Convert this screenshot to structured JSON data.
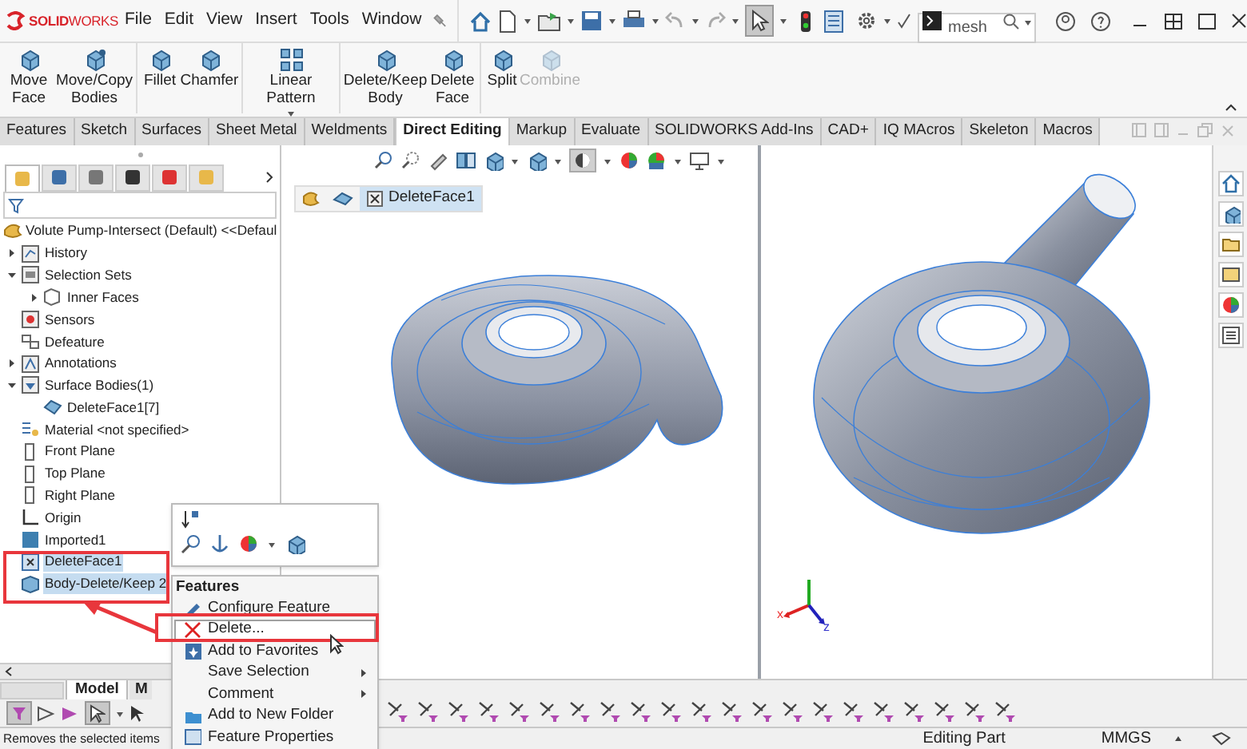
{
  "title_bar": {
    "logo": "**SOLID**WORKS",
    "menus": [
      "File",
      "Edit",
      "View",
      "Insert",
      "Tools",
      "Window"
    ],
    "search": {
      "value": "mesh"
    }
  },
  "ribbon": {
    "buttons": [
      {
        "label": "Move Face",
        "disabled": false
      },
      {
        "label": "Move/Copy Bodies",
        "disabled": false
      },
      {
        "label": "Fillet",
        "disabled": false
      },
      {
        "label": "Chamfer",
        "disabled": false
      },
      {
        "label": "Linear Pattern",
        "disabled": false
      },
      {
        "label": "Delete/Keep Body",
        "disabled": false
      },
      {
        "label": "Delete Face",
        "disabled": false
      },
      {
        "label": "Split",
        "disabled": false
      },
      {
        "label": "Combine",
        "disabled": true
      }
    ]
  },
  "tabs": [
    {
      "label": "Features",
      "selected": false
    },
    {
      "label": "Sketch",
      "selected": false
    },
    {
      "label": "Surfaces",
      "selected": false
    },
    {
      "label": "Sheet Metal",
      "selected": false
    },
    {
      "label": "Weldments",
      "selected": false
    },
    {
      "label": "Direct Editing",
      "selected": true
    },
    {
      "label": "Markup",
      "selected": false
    },
    {
      "label": "Evaluate",
      "selected": false
    },
    {
      "label": "SOLIDWORKS Add-Ins",
      "selected": false
    },
    {
      "label": "CAD+",
      "selected": false
    },
    {
      "label": "IQ MAcros",
      "selected": false
    },
    {
      "label": "Skeleton",
      "selected": false
    },
    {
      "label": "Macros",
      "selected": false
    }
  ],
  "panel_tabs": [
    {
      "selected": true
    },
    {
      "selected": false
    },
    {
      "selected": false
    },
    {
      "selected": false
    },
    {
      "selected": false
    },
    {
      "selected": false
    }
  ],
  "feature_tree": {
    "root": "Volute Pump-Intersect (Default) <<Defaul",
    "items": [
      {
        "label": "History",
        "expanded": false,
        "selected": false
      },
      {
        "label": "Selection Sets",
        "expanded": true,
        "selected": false,
        "children": [
          {
            "label": "Inner Faces",
            "expanded": false,
            "selected": false
          }
        ]
      },
      {
        "label": "Sensors",
        "selected": false
      },
      {
        "label": "Defeature",
        "selected": false
      },
      {
        "label": "Annotations",
        "expanded": false,
        "selected": false
      },
      {
        "label": "Surface Bodies(1)",
        "expanded": true,
        "selected": false,
        "children": [
          {
            "label": "DeleteFace1[7]",
            "selected": false
          }
        ]
      },
      {
        "label": "Material <not specified>",
        "selected": false
      },
      {
        "label": "Front Plane",
        "selected": false
      },
      {
        "label": "Top Plane",
        "selected": false
      },
      {
        "label": "Right Plane",
        "selected": false
      },
      {
        "label": "Origin",
        "selected": false
      },
      {
        "label": "Imported1",
        "selected": false
      },
      {
        "label": "DeleteFace1",
        "selected": true
      },
      {
        "label": "Body-Delete/Keep 2",
        "selected": true
      }
    ]
  },
  "breadcrumb": {
    "item": "DeleteFace1"
  },
  "triad": {
    "labels": [
      "x",
      "z"
    ]
  },
  "bottom_tabs": [
    {
      "label": "Model",
      "selected": true
    },
    {
      "label": "M",
      "selected": false
    }
  ],
  "context_menu": {
    "header": "Features",
    "items": [
      {
        "label": "Configure Feature",
        "submenu": false,
        "hovered": false
      },
      {
        "label": "Delete...",
        "submenu": false,
        "hovered": true
      },
      {
        "label": "Add to Favorites",
        "submenu": false,
        "hovered": false
      },
      {
        "label": "Save Selection",
        "submenu": true,
        "hovered": false
      },
      {
        "label": "Comment",
        "submenu": true,
        "hovered": false
      },
      {
        "label": "Add to New Folder",
        "submenu": false,
        "hovered": false
      },
      {
        "label": "Feature Properties",
        "submenu": false,
        "hovered": false
      }
    ]
  },
  "status_bar": {
    "message": "Removes the selected items",
    "mode": "Editing Part",
    "units": "MMGS"
  }
}
